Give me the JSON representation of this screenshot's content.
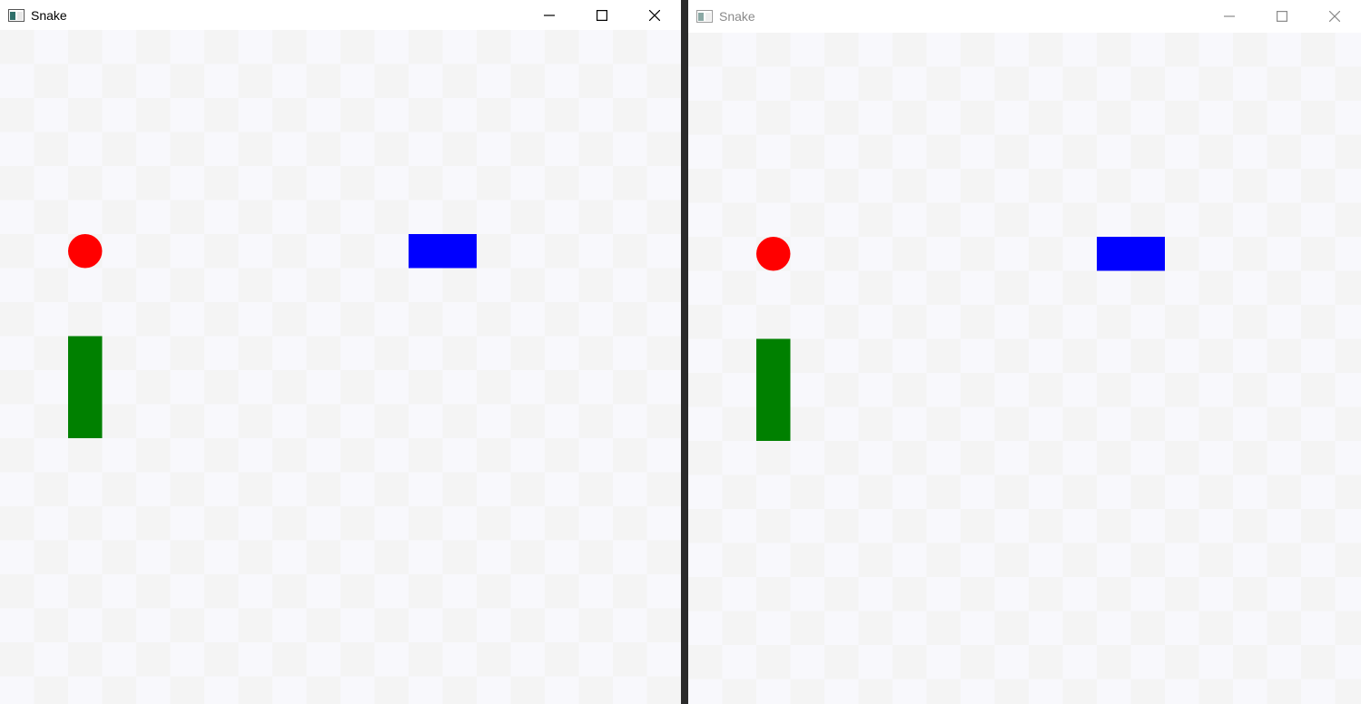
{
  "colors": {
    "cell_light": "#f8f8fc",
    "cell_dark": "#f4f4f4",
    "food": "#ff0000",
    "snake": "#008000",
    "player2": "#0000ff",
    "icon_active": "#2f6f6a",
    "icon_inactive": "#8aa8a4",
    "controls_active": "#000000",
    "controls_inactive": "#8a8a8a"
  },
  "windows": [
    {
      "title": "Snake",
      "state": "active",
      "icon": "app-window-icon",
      "controls": [
        "minimize-icon",
        "maximize-icon",
        "close-icon"
      ]
    },
    {
      "title": "Snake",
      "state": "inactive",
      "icon": "app-window-icon",
      "controls": [
        "minimize-icon",
        "maximize-icon",
        "close-icon"
      ]
    }
  ],
  "board": {
    "cols": 20,
    "rows": 20,
    "food": {
      "col": 2,
      "row": 6
    },
    "green_block": {
      "col": 2,
      "row": 9,
      "length": 3,
      "orientation": "vertical"
    },
    "blue_block": {
      "col": 12,
      "row": 6,
      "length": 2,
      "orientation": "horizontal"
    }
  }
}
